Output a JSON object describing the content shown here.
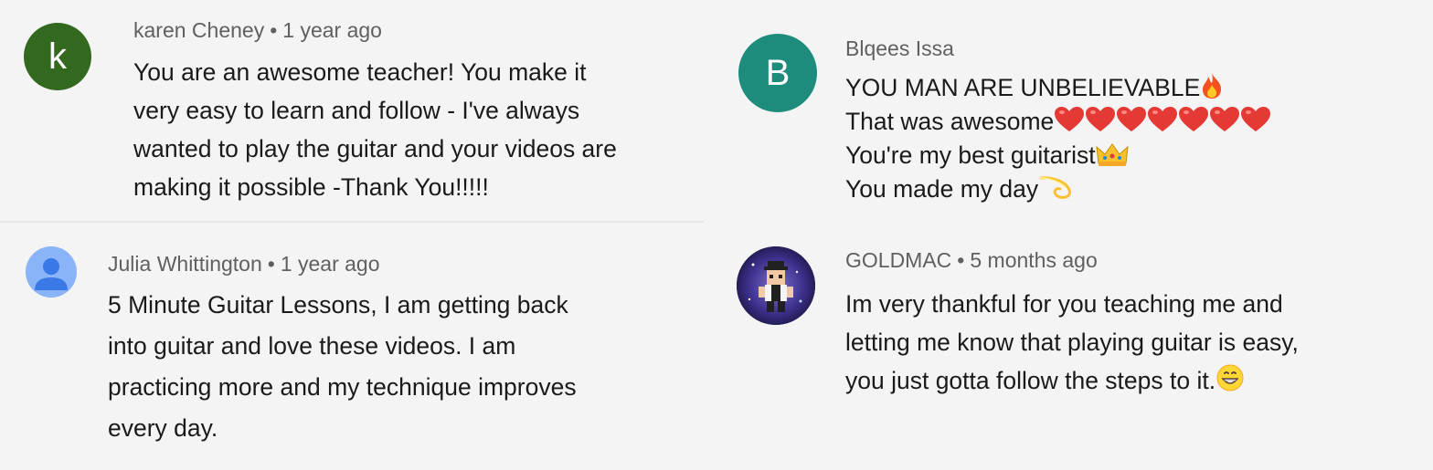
{
  "colors": {
    "background": "#f4f4f4",
    "avatar_k": "#33691e",
    "avatar_b": "#1e8c7c",
    "avatar_default": "#8ab4f8",
    "meta_text": "#606060",
    "body_text": "#1a1a1a"
  },
  "comments": [
    {
      "author": "karen Cheney",
      "time": "1 year ago",
      "avatar_letter": "k",
      "lines": [
        "You are an awesome teacher!  You make it",
        "very easy to learn and follow - I've always",
        "wanted to play the guitar and your videos are",
        "making it possible -Thank You!!!!!"
      ]
    },
    {
      "author": "Julia Whittington",
      "time": "1 year ago",
      "avatar_icon": "default-person-icon",
      "lines": [
        "5 Minute Guitar Lessons,  I am getting back",
        "into guitar and love these videos.  I am",
        "practicing more and my technique improves",
        "every day."
      ]
    },
    {
      "author": "Blqees Issa",
      "avatar_letter": "B",
      "lines": [
        "YOU MAN ARE UNBELIEVABLE",
        "That was awesome",
        "You're my best guitarist",
        "You made my day"
      ],
      "emojis": {
        "line1": "fire-emoji",
        "line2": [
          "heart-emoji",
          "heart-emoji",
          "heart-emoji",
          "heart-emoji",
          "heart-emoji",
          "heart-emoji",
          "heart-emoji"
        ],
        "line3": "crown-emoji",
        "line4": "dizzy-emoji"
      }
    },
    {
      "author": "GOLDMAC",
      "time": "5 months ago",
      "avatar_icon": "pixel-character-avatar",
      "lines": [
        "Im very thankful for you teaching me and",
        "letting me know that playing guitar is easy,",
        "you just gotta follow the steps to it."
      ],
      "emojis": {
        "line3": "grinning-emoji"
      }
    }
  ]
}
